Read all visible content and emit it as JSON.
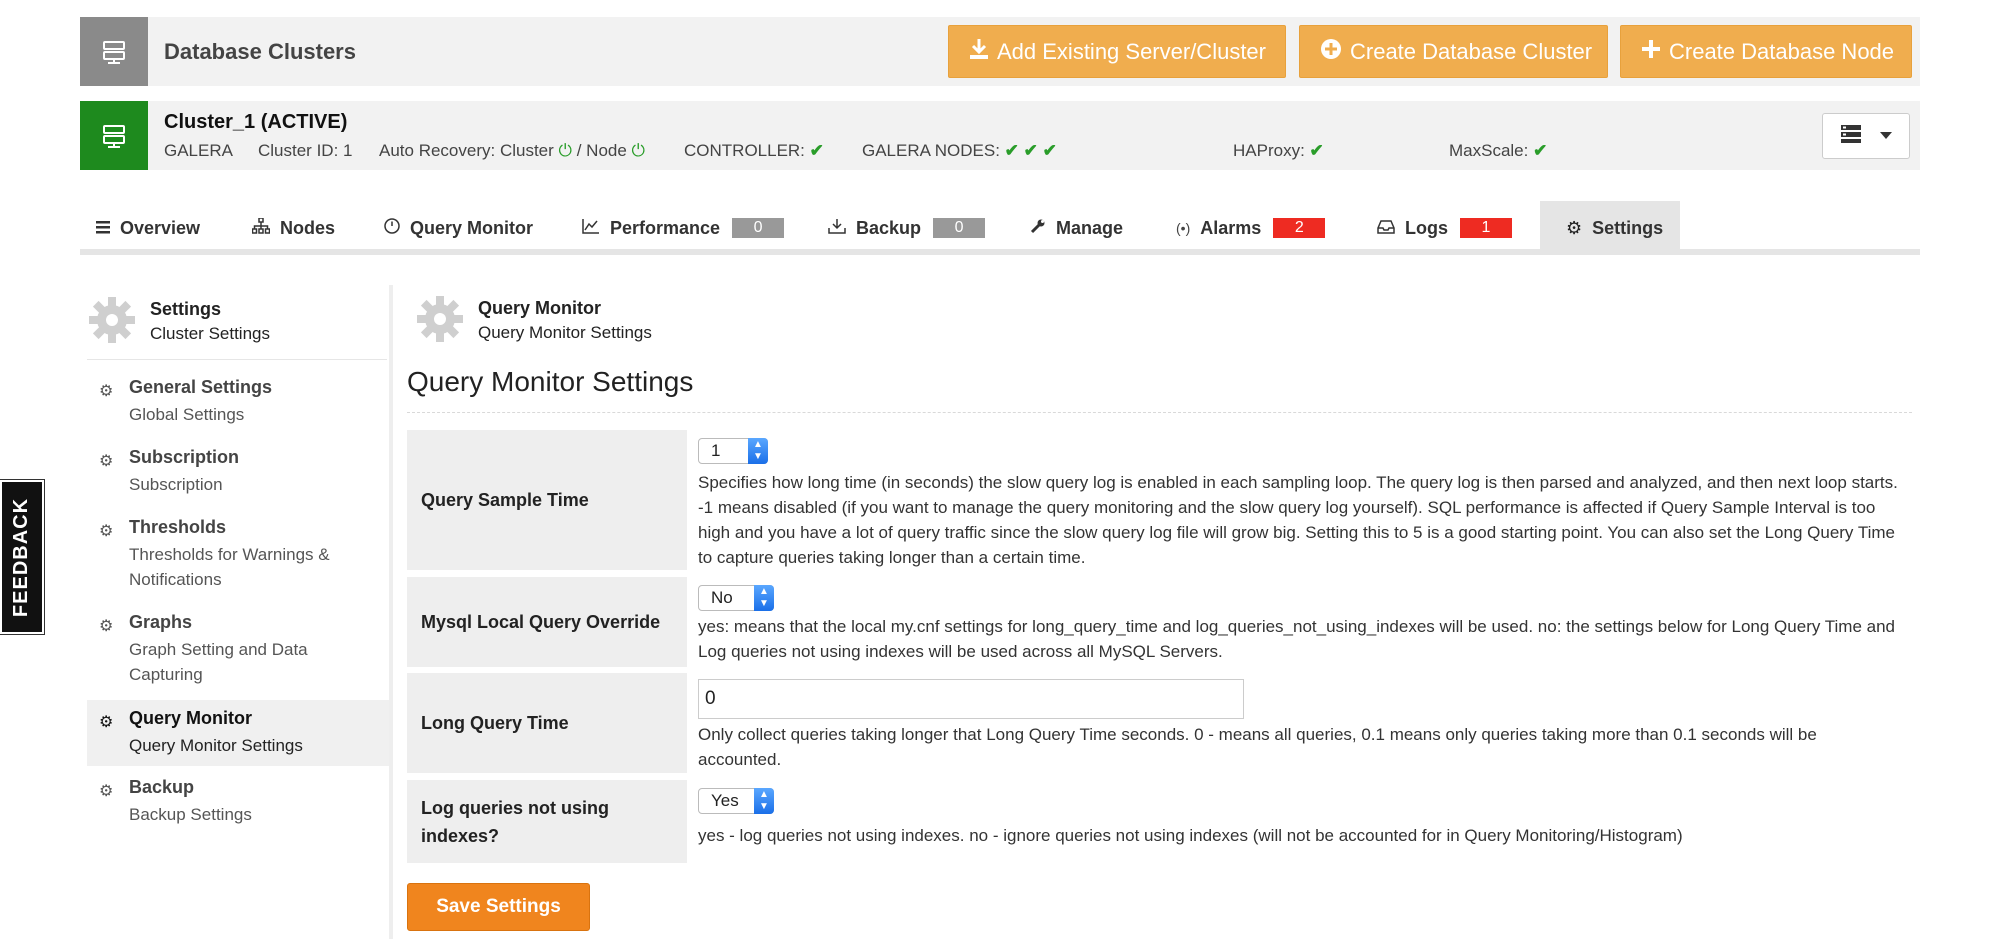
{
  "header": {
    "title": "Database Clusters",
    "buttons": {
      "add_existing": "Add Existing Server/Cluster",
      "create_cluster": "Create Database Cluster",
      "create_node": "Create Database Node"
    }
  },
  "cluster": {
    "name": "Cluster_1 (ACTIVE)",
    "type": "GALERA",
    "cluster_id": "Cluster ID: 1",
    "auto_recovery_label": "Auto Recovery: Cluster",
    "node_label": "/ Node",
    "controller_label": "CONTROLLER:",
    "galera_nodes_label": "GALERA NODES:",
    "haproxy_label": "HAProxy:",
    "maxscale_label": "MaxScale:"
  },
  "tabs": [
    {
      "label": "Overview"
    },
    {
      "label": "Nodes"
    },
    {
      "label": "Query Monitor"
    },
    {
      "label": "Performance",
      "count": "0"
    },
    {
      "label": "Backup",
      "count": "0"
    },
    {
      "label": "Manage"
    },
    {
      "label": "Alarms",
      "count": "2"
    },
    {
      "label": "Logs",
      "count": "1"
    },
    {
      "label": "Settings"
    }
  ],
  "sidebar": {
    "heading": "Settings",
    "subheading": "Cluster Settings",
    "items": [
      {
        "title": "General Settings",
        "subtitle": "Global Settings"
      },
      {
        "title": "Subscription",
        "subtitle": "Subscription"
      },
      {
        "title": "Thresholds",
        "subtitle": "Thresholds for Warnings & Notifications"
      },
      {
        "title": "Graphs",
        "subtitle": "Graph Setting and Data Capturing"
      },
      {
        "title": "Query Monitor",
        "subtitle": "Query Monitor Settings"
      },
      {
        "title": "Backup",
        "subtitle": "Backup Settings"
      }
    ]
  },
  "main": {
    "heading": "Query Monitor",
    "subheading": "Query Monitor Settings",
    "page_title": "Query Monitor Settings",
    "fields": {
      "sample_time": {
        "label": "Query Sample Time",
        "value": "1",
        "description": "Specifies how long time (in seconds) the slow query log is enabled in each sampling loop. The query log is then parsed and analyzed, and then next loop starts. -1 means disabled (if you want to manage the query monitoring and the slow query log yourself). SQL performance is affected if Query Sample Interval is too high and you have a lot of query traffic since the slow query log file will grow big. Setting this to 5 is a good starting point. You can also set the Long Query Time to capture queries taking longer than a certain time."
      },
      "local_override": {
        "label": "Mysql Local Query Override",
        "value": "No",
        "description": "yes: means that the local my.cnf settings for long_query_time and log_queries_not_using_indexes will be used. no: the settings below for Long Query Time and Log queries not using indexes will be used across all MySQL Servers."
      },
      "long_query_time": {
        "label": "Long Query Time",
        "value": "0",
        "description": "Only collect queries taking longer that Long Query Time seconds. 0 - means all queries, 0.1 means only queries taking more than 0.1 seconds will be accounted."
      },
      "log_no_index": {
        "label": "Log queries not using indexes?",
        "value": "Yes",
        "description": "yes - log queries not using indexes. no - ignore queries not using indexes (will not be accounted for in Query Monitoring/Histogram)"
      }
    },
    "save_label": "Save Settings"
  },
  "feedback": "FEEDBACK",
  "colors": {
    "orange": "#f0ad4e",
    "save_orange": "#f0851e",
    "green": "#1e8a1e",
    "red_badge": "#ee2b22"
  }
}
